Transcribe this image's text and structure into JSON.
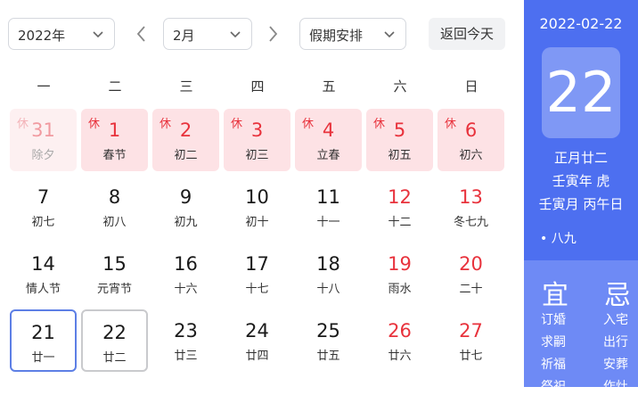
{
  "toolbar": {
    "year_select": "2022年",
    "month_select": "2月",
    "holiday_select": "假期安排",
    "today_button": "返回今天"
  },
  "weekdays": [
    "一",
    "二",
    "三",
    "四",
    "五",
    "六",
    "日"
  ],
  "weeks": [
    [
      {
        "day": "31",
        "lunar": "除夕",
        "badge": "休",
        "type": "hol-faded"
      },
      {
        "day": "1",
        "lunar": "春节",
        "badge": "休",
        "type": "hol"
      },
      {
        "day": "2",
        "lunar": "初二",
        "badge": "休",
        "type": "hol"
      },
      {
        "day": "3",
        "lunar": "初三",
        "badge": "休",
        "type": "hol"
      },
      {
        "day": "4",
        "lunar": "立春",
        "badge": "休",
        "type": "hol"
      },
      {
        "day": "5",
        "lunar": "初五",
        "badge": "休",
        "type": "hol"
      },
      {
        "day": "6",
        "lunar": "初六",
        "badge": "休",
        "type": "hol"
      }
    ],
    [
      {
        "day": "7",
        "lunar": "初七",
        "badge": "",
        "type": "normal"
      },
      {
        "day": "8",
        "lunar": "初八",
        "badge": "",
        "type": "normal"
      },
      {
        "day": "9",
        "lunar": "初九",
        "badge": "",
        "type": "normal"
      },
      {
        "day": "10",
        "lunar": "初十",
        "badge": "",
        "type": "normal"
      },
      {
        "day": "11",
        "lunar": "十一",
        "badge": "",
        "type": "normal"
      },
      {
        "day": "12",
        "lunar": "十二",
        "badge": "",
        "type": "weekend"
      },
      {
        "day": "13",
        "lunar": "冬七九",
        "badge": "",
        "type": "weekend"
      }
    ],
    [
      {
        "day": "14",
        "lunar": "情人节",
        "badge": "",
        "type": "normal"
      },
      {
        "day": "15",
        "lunar": "元宵节",
        "badge": "",
        "type": "normal"
      },
      {
        "day": "16",
        "lunar": "十六",
        "badge": "",
        "type": "normal"
      },
      {
        "day": "17",
        "lunar": "十七",
        "badge": "",
        "type": "normal"
      },
      {
        "day": "18",
        "lunar": "十八",
        "badge": "",
        "type": "normal"
      },
      {
        "day": "19",
        "lunar": "雨水",
        "badge": "",
        "type": "weekend"
      },
      {
        "day": "20",
        "lunar": "二十",
        "badge": "",
        "type": "weekend"
      }
    ],
    [
      {
        "day": "21",
        "lunar": "廿一",
        "badge": "",
        "type": "selected"
      },
      {
        "day": "22",
        "lunar": "廿二",
        "badge": "",
        "type": "today"
      },
      {
        "day": "23",
        "lunar": "廿三",
        "badge": "",
        "type": "normal"
      },
      {
        "day": "24",
        "lunar": "廿四",
        "badge": "",
        "type": "normal"
      },
      {
        "day": "25",
        "lunar": "廿五",
        "badge": "",
        "type": "normal"
      },
      {
        "day": "26",
        "lunar": "廿六",
        "badge": "",
        "type": "weekend"
      },
      {
        "day": "27",
        "lunar": "廿七",
        "badge": "",
        "type": "weekend"
      }
    ]
  ],
  "sidebar": {
    "date": "2022-02-22",
    "big_day": "22",
    "lunar_date": "正月廿二",
    "year_gz": "壬寅年 虎",
    "month_day_gz": "壬寅月 丙午日",
    "nine": "• 八九",
    "yi_label": "宜",
    "ji_label": "忌",
    "yi": [
      "订婚",
      "求嗣",
      "祈福",
      "祭祀"
    ],
    "ji": [
      "入宅",
      "出行",
      "安葬",
      "作灶"
    ]
  },
  "colors": {
    "accent": "#4d6ff0",
    "holiday_bg": "#fde2e5",
    "red": "#e8323c",
    "selected_border": "#5d7fe5"
  }
}
